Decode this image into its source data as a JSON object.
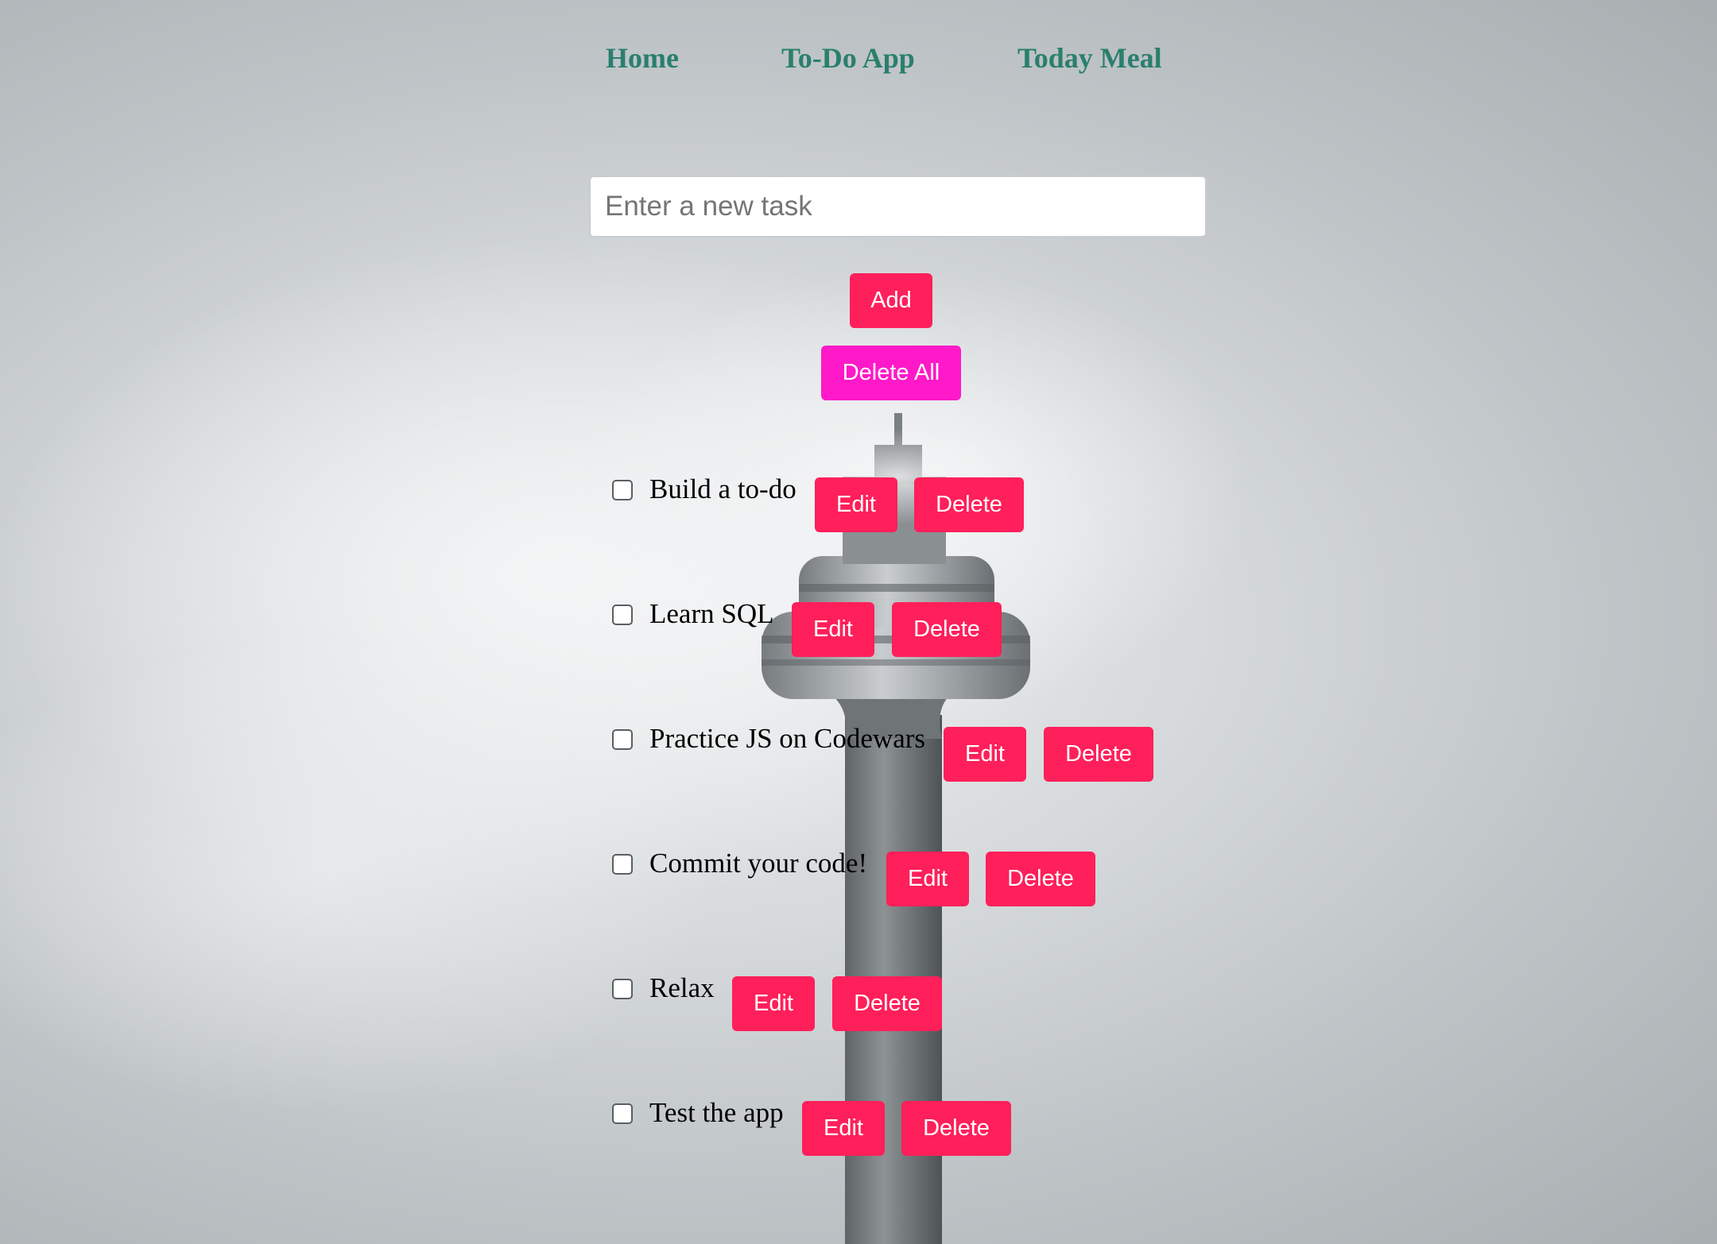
{
  "nav": {
    "home": "Home",
    "todo": "To-Do App",
    "meal": "Today Meal"
  },
  "input": {
    "placeholder": "Enter a new task",
    "value": ""
  },
  "buttons": {
    "add": "Add",
    "delete_all": "Delete All",
    "edit": "Edit",
    "delete": "Delete"
  },
  "colors": {
    "nav_link": "#2a7f6d",
    "primary_button": "#ff1f5a",
    "delete_all_button": "#ff19c9"
  },
  "tasks": [
    {
      "text": "Build a to-do",
      "checked": false
    },
    {
      "text": "Learn SQL",
      "checked": false
    },
    {
      "text": "Practice JS on Codewars",
      "checked": false
    },
    {
      "text": "Commit your code!",
      "checked": false
    },
    {
      "text": "Relax",
      "checked": false
    },
    {
      "text": "Test the app",
      "checked": false
    }
  ]
}
